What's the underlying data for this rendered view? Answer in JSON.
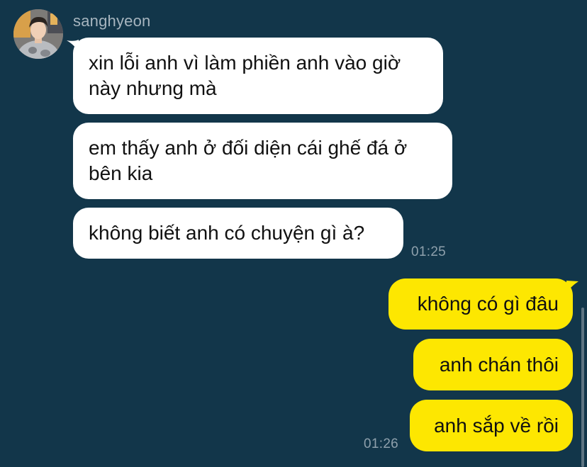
{
  "contact": {
    "name": "sanghyeon",
    "avatar_icon": "person-photo-avatar"
  },
  "incoming": [
    {
      "lines": [
        "xin lỗi anh vì làm phiền anh vào giờ",
        "này nhưng mà"
      ]
    },
    {
      "lines": [
        "em thấy anh ở đối diện cái ghế đá ở",
        "bên kia"
      ]
    },
    {
      "lines": [
        "không biết anh có chuyện gì à?"
      ]
    }
  ],
  "incoming_time": "01:25",
  "outgoing": [
    {
      "text": "không có gì đâu"
    },
    {
      "text": "anh chán thôi"
    },
    {
      "text": "anh sắp về rồi"
    }
  ],
  "outgoing_time": "01:26",
  "colors": {
    "background": "#12364a",
    "incoming_bubble": "#ffffff",
    "outgoing_bubble": "#fde701",
    "meta_text": "#8ea0ac"
  }
}
